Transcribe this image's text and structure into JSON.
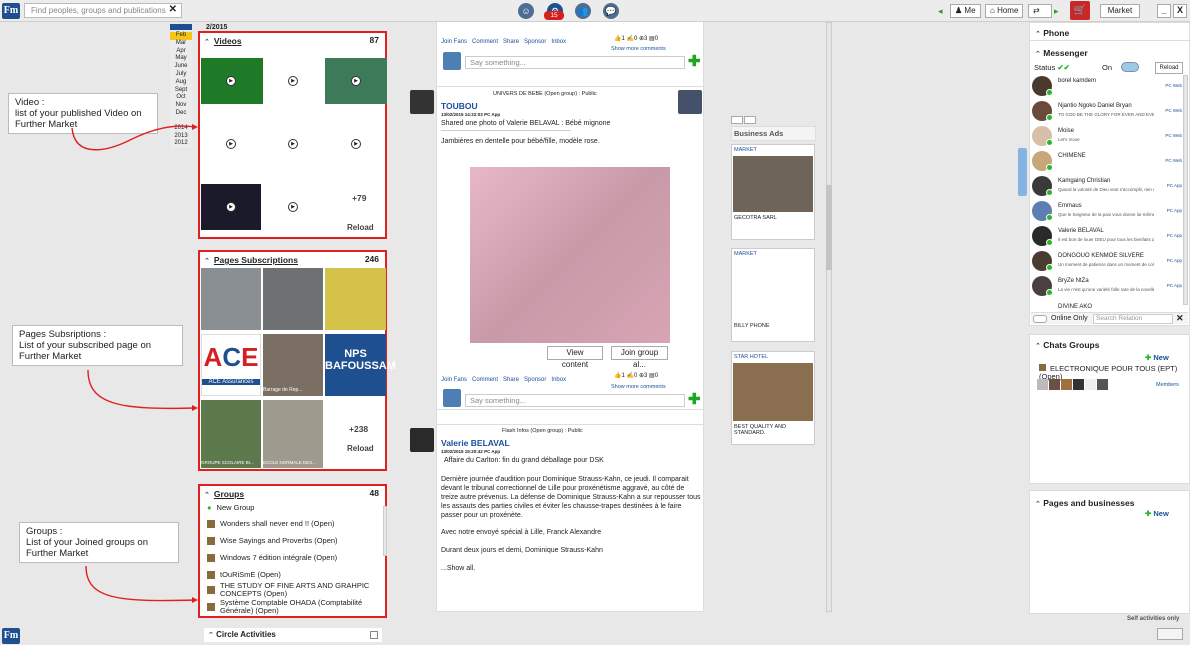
{
  "app": {
    "logo": "Fm",
    "search_placeholder": "Find peoples, groups and publications",
    "notif_count": "15"
  },
  "topnav": {
    "me": "Me",
    "home": "Home",
    "market": "Market",
    "minimize": "_",
    "close": "X"
  },
  "left": {
    "year_label": "2/2015",
    "months": [
      "Feb",
      "Mar",
      "Apr",
      "May",
      "June",
      "July",
      "Aug",
      "Sept",
      "Oct",
      "Nov",
      "Dec"
    ],
    "selected_month": "Feb",
    "years": [
      "2014",
      "2013",
      "2012"
    ]
  },
  "annotations": [
    {
      "lines": [
        "Video :",
        "list of your published Video on",
        "Further Market"
      ]
    },
    {
      "lines": [
        "Pages Subsriptions :",
        "List of your subscribed page on",
        "Further Market"
      ]
    },
    {
      "lines": [
        "Groups :",
        "List of your Joined groups on",
        "Further Market"
      ]
    }
  ],
  "videos": {
    "title": "Videos",
    "count": "87",
    "more": "+79",
    "reload": "Reload"
  },
  "pages": {
    "title": "Pages Subscriptions",
    "count": "246",
    "more": "+238",
    "reload": "Reload",
    "thumbs": [
      "ACE Assurances",
      "Barrage de Rep...",
      "NPS BAFOUSSAM",
      "GROUPE SCOLAIRE BI...",
      "ECOLE NORMALE DES..."
    ]
  },
  "groups": {
    "title": "Groups",
    "count": "48",
    "items": [
      "New Group",
      "Wonders shall never end !! (Open)",
      "Wise Sayings and Proverbs (Open)",
      "Windows 7 édition intégrale (Open)",
      "tOuRiSmE (Open)",
      "THE STUDY OF FINE ARTS AND GRAHPIC CONCEPTS (Open)",
      "Système Comptable OHADA (Comptabilité Générale) (Open)"
    ]
  },
  "circle": {
    "title": "Circle Activities"
  },
  "feed": {
    "actions": [
      "Join Fans",
      "Comment",
      "Share",
      "Sponsor",
      "Inbox"
    ],
    "counts1": [
      "1",
      "0",
      "3",
      "0"
    ],
    "counts2": [
      "1",
      "0",
      "3",
      "0"
    ],
    "show_more": "Show more comments",
    "comment_placeholder": "Say something...",
    "post1": {
      "group": "UNIVERS DE BEBE (Open group) : Public",
      "author": "TOUBOU",
      "date": "13/02/2015 14:22:03",
      "device": "PC App",
      "headline": "Shared one photo of  Valerie BELAVAL : Bébé mignone",
      "divider": "------------------------------------------------------------------------------",
      "text": "Jambières en dentelle pour bébé/fille, modèle rose.",
      "view": "View content",
      "join": "Join group al..."
    },
    "post2": {
      "group": "Flash Infos (Open group) : Public",
      "author": "Valerie BELAVAL",
      "date": "13/02/2015 15:20:42",
      "device": "PC App",
      "p1": "Affaire du Carlton: fin du grand déballage pour DSK",
      "p2": "Dernière journée d'audition pour Dominique Strauss-Kahn, ce jeudi. Il comparait devant le tribunal correctionnel de Lille pour proxénétisme aggravé, au côté de treize autre prévenus. La défense de Dominique Strauss-Kahn a sur repousser tous les assauts des parties civiles et éviter les chausse-trapes destinées à le faire passer pour un proxénète.",
      "p3": "Avec notre envoyé spécial à Lille, Franck Alexandre",
      "p4": "Durant deux jours et demi, Dominique Strauss-Kahn",
      "more": "...Show all."
    }
  },
  "ads": {
    "title": "Business Ads",
    "items": [
      {
        "tag": "MARKET",
        "name": "GECOTRA SARL"
      },
      {
        "tag": "MARKET",
        "name": "BILLY PHONE"
      },
      {
        "tag": "STAR HOTEL",
        "name": "BEST QUALITY AND STANDARD."
      }
    ]
  },
  "right": {
    "phone": "Phone",
    "messenger": "Messenger",
    "status": "Status",
    "on": "On",
    "reload": "Reload",
    "contacts": [
      {
        "name": "borel kamdem",
        "status": "",
        "dev": "PC Web"
      },
      {
        "name": "Njantio Ngoko Daniel Bryan",
        "status": "TO GOD BE THE GLORY FOR EVER AND EVER",
        "dev": "PC Web"
      },
      {
        "name": "Moise",
        "status": "Let's move",
        "dev": "PC Web"
      },
      {
        "name": "CHIMENE",
        "status": "",
        "dev": "PC Web"
      },
      {
        "name": "Kamgaing Christian",
        "status": "Quand la volonté de Dieu veut s'accomplir, rien ne peut l'arrêter",
        "dev": "PC App"
      },
      {
        "name": "Emmaus",
        "status": "Que le Seigneur de la paix vous donne lui-même la paix",
        "dev": "PC App"
      },
      {
        "name": "Valerie BELAVAL",
        "status": "Il est bon de louer DIEU pour tous les bienfaits qu'il...",
        "dev": "PC App"
      },
      {
        "name": "DONGOUO KENMOE SILVERE",
        "status": "Un moment de patience dans un moment de colère...",
        "dev": "PC App"
      },
      {
        "name": "BryZe NtZa",
        "status": "La vie n'est qu'une variété folle rare de la novelle...",
        "dev": "PC App"
      },
      {
        "name": "DIVINE AKO",
        "status": "",
        "dev": ""
      }
    ],
    "online_only": "Online Only",
    "search_relation": "Search Relation",
    "chats_groups": "Chats Groups",
    "new": "New",
    "chat_group_name": "ELECTRONIQUE POUR TOUS (EPT) (Open)",
    "members": "Members",
    "pages_businesses": "Pages and businesses",
    "new2": "New",
    "footer": "Self activities only"
  }
}
